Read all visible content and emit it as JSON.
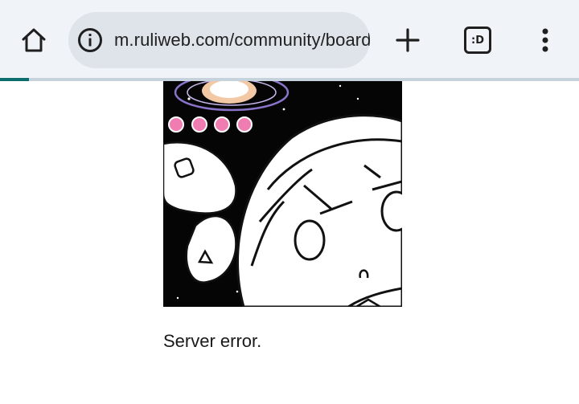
{
  "browser": {
    "url": "m.ruliweb.com/community/board",
    "tab_count": ":D",
    "load_progress": 0.05
  },
  "page": {
    "error_message": "Server error."
  },
  "icons": {
    "home": "home-icon",
    "site_info": "info-icon",
    "new_tab": "plus-icon",
    "tabs": "tab-switcher-icon",
    "menu": "more-vert-icon"
  },
  "colors": {
    "toolbar_bg": "#f0f4f9",
    "omnibox_bg": "#dfe4eb",
    "progress": "#0b6e6e"
  }
}
